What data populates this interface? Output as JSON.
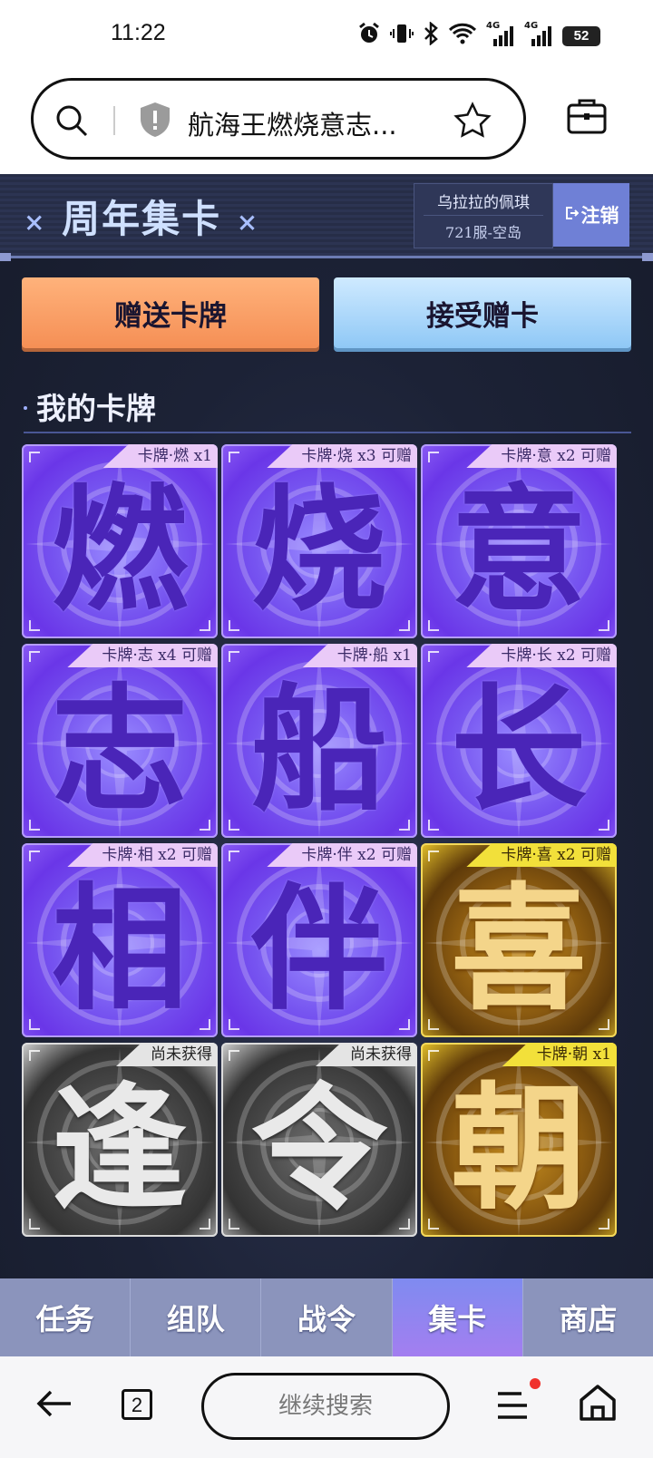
{
  "status_bar": {
    "time": "11:22",
    "battery": "52",
    "signal1": "4G",
    "signal2": "4G"
  },
  "browser": {
    "page_title": "航海王燃烧意志...",
    "tab_count": "2",
    "continue_search": "继续搜索"
  },
  "header": {
    "title": "周年集卡",
    "x_mark": "×",
    "user_name": "乌拉拉的佩琪",
    "server": "721服-空岛",
    "logout": "注销"
  },
  "actions": {
    "gift": "赠送卡牌",
    "receive": "接受赠卡"
  },
  "section": {
    "title": "我的卡牌"
  },
  "cards": [
    {
      "char": "燃",
      "tag": "卡牌·燃 x1",
      "style": "purple"
    },
    {
      "char": "烧",
      "tag": "卡牌·烧 x3 可赠",
      "style": "purple"
    },
    {
      "char": "意",
      "tag": "卡牌·意 x2 可赠",
      "style": "purple"
    },
    {
      "char": "志",
      "tag": "卡牌·志 x4 可赠",
      "style": "purple"
    },
    {
      "char": "船",
      "tag": "卡牌·船 x1",
      "style": "purple"
    },
    {
      "char": "长",
      "tag": "卡牌·长 x2 可赠",
      "style": "purple"
    },
    {
      "char": "相",
      "tag": "卡牌·相 x2 可赠",
      "style": "purple"
    },
    {
      "char": "伴",
      "tag": "卡牌·伴 x2 可赠",
      "style": "purple"
    },
    {
      "char": "喜",
      "tag": "卡牌·喜 x2 可赠",
      "style": "gold"
    },
    {
      "char": "逢",
      "tag": "尚未获得",
      "style": "grey"
    },
    {
      "char": "令",
      "tag": "尚未获得",
      "style": "grey"
    },
    {
      "char": "朝",
      "tag": "卡牌·朝 x1",
      "style": "gold"
    }
  ],
  "tabs": [
    {
      "label": "任务",
      "active": false
    },
    {
      "label": "组队",
      "active": false
    },
    {
      "label": "战令",
      "active": false
    },
    {
      "label": "集卡",
      "active": true
    },
    {
      "label": "商店",
      "active": false
    }
  ],
  "colors": {
    "accent": "#6f80d6",
    "gift_button": "#f58f55",
    "receive_button": "#8fc8f6",
    "card_purple": "#7654f0",
    "card_gold": "#e8c42a",
    "card_grey": "#4a4a4a"
  }
}
